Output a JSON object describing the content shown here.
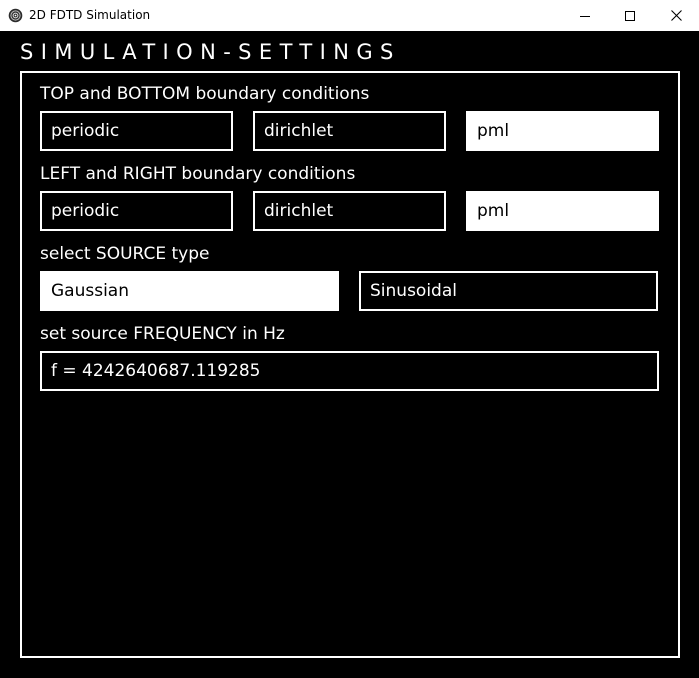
{
  "window": {
    "title": "2D FDTD Simulation",
    "icon": "app-icon"
  },
  "heading": "SIMULATION-SETTINGS",
  "top_bottom": {
    "label": "TOP and BOTTOM boundary conditions",
    "options": [
      "periodic",
      "dirichlet",
      "pml"
    ],
    "selected": "pml"
  },
  "left_right": {
    "label": "LEFT and RIGHT boundary conditions",
    "options": [
      "periodic",
      "dirichlet",
      "pml"
    ],
    "selected": "pml"
  },
  "source": {
    "label": "select SOURCE type",
    "options": [
      "Gaussian",
      "Sinusoidal"
    ],
    "selected": "Gaussian"
  },
  "frequency": {
    "label": "set source FREQUENCY in Hz",
    "value": "f = 4242640687.119285"
  },
  "colors": {
    "background": "#000000",
    "foreground": "#ffffff",
    "selected_fill": "#ffffff",
    "selected_text": "#000000"
  }
}
